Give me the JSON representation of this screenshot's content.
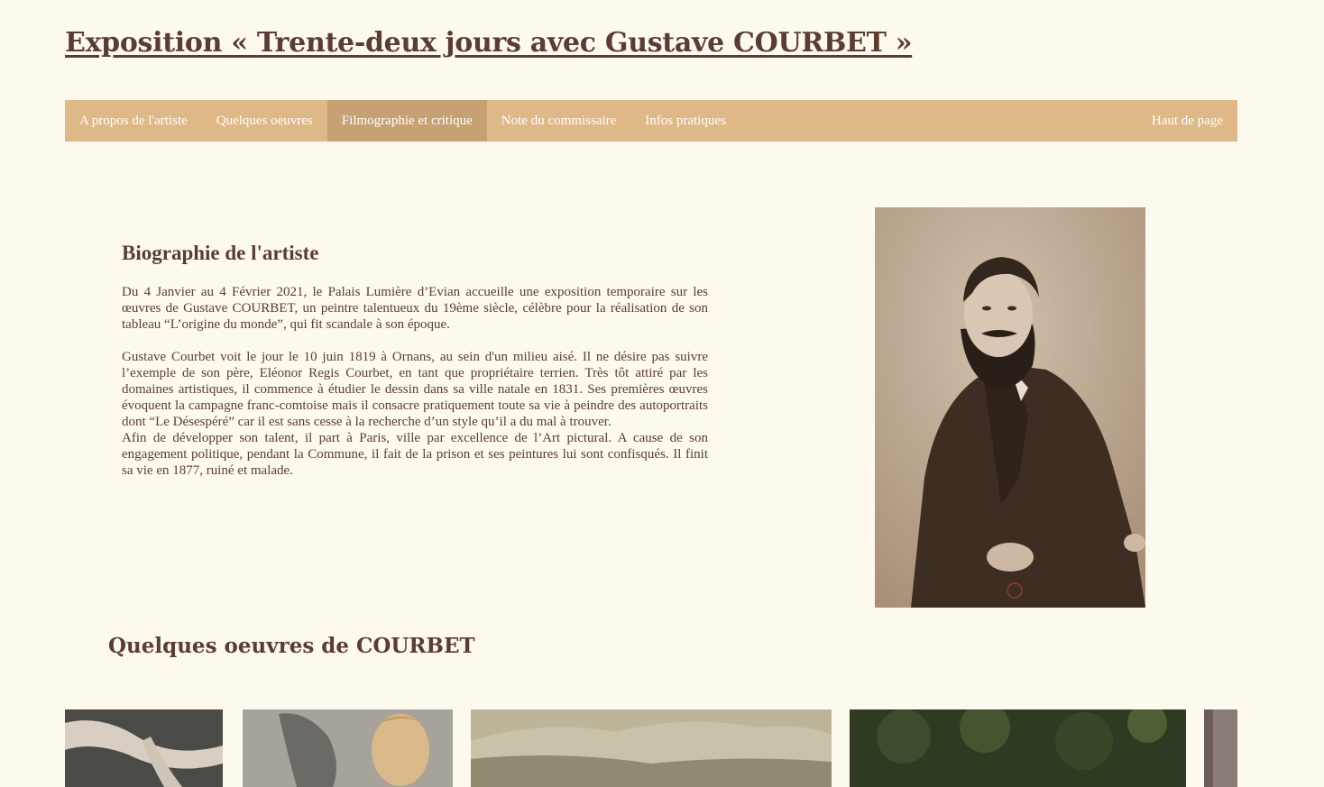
{
  "header": {
    "title": "Exposition « Trente-deux jours avec Gustave COURBET »"
  },
  "nav": {
    "items": [
      {
        "label": "A propos de l'artiste",
        "active": false
      },
      {
        "label": "Quelques oeuvres",
        "active": false
      },
      {
        "label": "Filmographie et critique",
        "active": true
      },
      {
        "label": "Note du commissaire",
        "active": false
      },
      {
        "label": "Infos pratiques",
        "active": false
      }
    ],
    "top_link": "Haut de page"
  },
  "bio": {
    "heading": "Biographie de l'artiste",
    "paragraphs": [
      "Du 4 Janvier au 4 Février 2021, le Palais Lumière d’Evian accueille une exposition temporaire sur les œuvres de Gustave COURBET, un peintre talentueux du 19ème siècle, célèbre pour la réalisation de son tableau “L’origine du monde”, qui fit scandale à son époque.",
      "Gustave Courbet voit le jour le 10 juin 1819 à Ornans, au sein d'un milieu aisé. Il ne désire pas suivre l’exemple de son père, Eléonor Regis Courbet, en tant que propriétaire terrien. Très tôt attiré par les domaines artistiques, il commence à étudier le dessin dans sa ville natale en 1831. Ses premières œuvres évoquent la campagne franc-comtoise mais il consacre pratiquement toute sa vie à peindre des autoportraits dont “Le Désespéré” car il est sans cesse à la recherche d’un style qu’il a du mal à trouver.",
      "Afin de développer son talent, il part à Paris, ville par excellence de l’Art pictural. A cause de son engagement politique, pendant la Commune, il fait de la prison et ses peintures lui sont confisqués. Il finit sa vie en 1877, ruiné et malade."
    ]
  },
  "works": {
    "heading": "Quelques oeuvres de COURBET"
  },
  "colors": {
    "background": "#fef9ee",
    "text": "#5a3d32",
    "nav_bg": "#dfb888",
    "nav_active": "#c7a074"
  }
}
